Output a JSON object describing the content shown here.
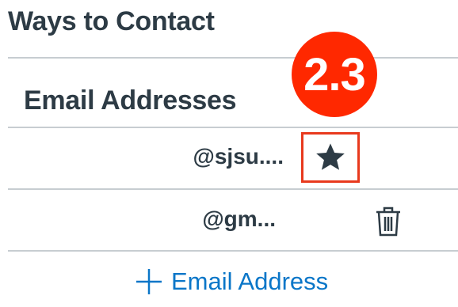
{
  "ways_to_contact": {
    "title": "Ways to Contact"
  },
  "email_addresses": {
    "title": "Email Addresses",
    "items": [
      {
        "address": "@sjsu....",
        "action_icon": "star-icon"
      },
      {
        "address": "@gm...",
        "action_icon": "trash-icon"
      }
    ],
    "add_label": "Email Address"
  },
  "annotation": {
    "badge_text": "2.3",
    "badge_color": "#ff2800",
    "highlight_color": "#e8391d"
  },
  "colors": {
    "text": "#2d3b45",
    "link": "#0a76c8",
    "divider": "#c7cdd1"
  }
}
